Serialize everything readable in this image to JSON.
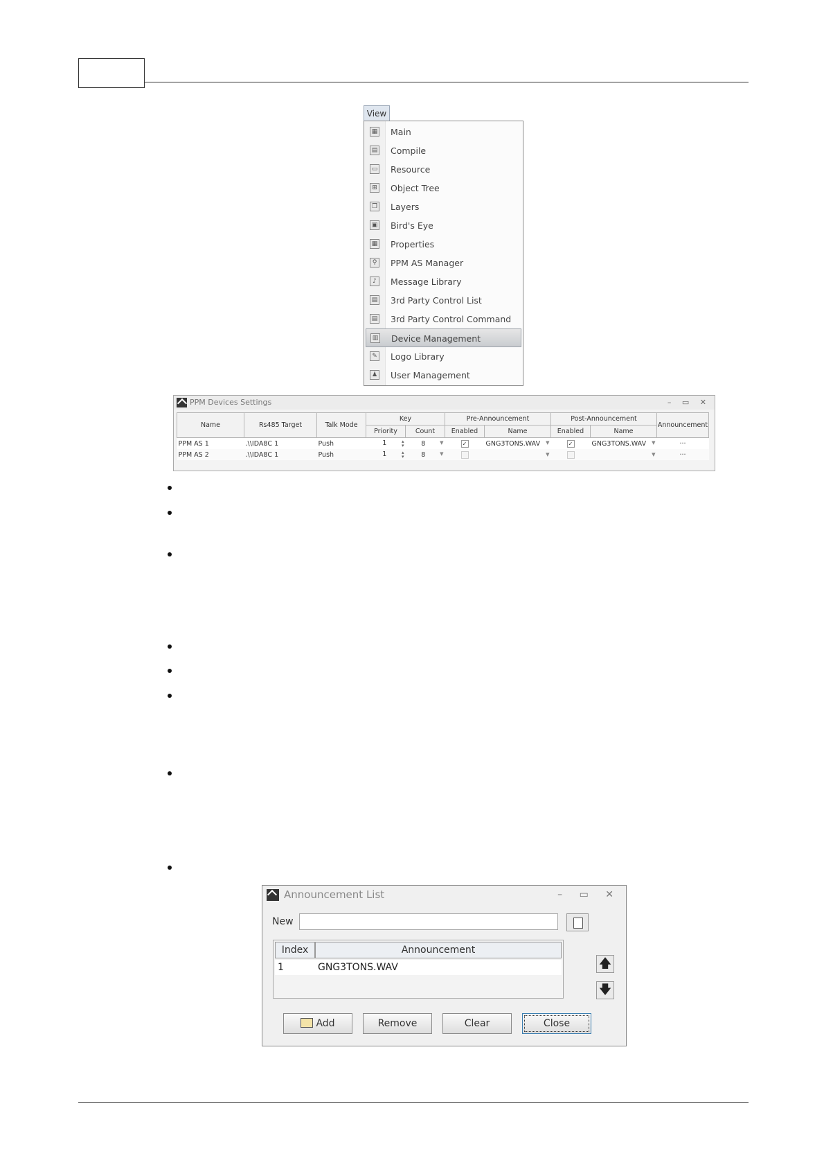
{
  "view_menu": {
    "tab_label": "View",
    "items": [
      {
        "label": "Main",
        "icon": "main-window-icon"
      },
      {
        "label": "Compile",
        "icon": "compile-icon"
      },
      {
        "label": "Resource",
        "icon": "resource-icon"
      },
      {
        "label": "Object Tree",
        "icon": "object-tree-icon"
      },
      {
        "label": "Layers",
        "icon": "layers-icon"
      },
      {
        "label": "Bird's Eye",
        "icon": "birds-eye-icon"
      },
      {
        "label": "Properties",
        "icon": "properties-icon"
      },
      {
        "label": "PPM AS Manager",
        "icon": "ppm-as-manager-icon"
      },
      {
        "label": "Message Library",
        "icon": "message-library-icon"
      },
      {
        "label": "3rd Party Control List",
        "icon": "third-party-list-icon"
      },
      {
        "label": "3rd Party Control Command",
        "icon": "third-party-command-icon"
      },
      {
        "label": "Device Management",
        "icon": "device-management-icon",
        "highlighted": true
      },
      {
        "label": "Logo Library",
        "icon": "logo-library-icon"
      },
      {
        "label": "User Management",
        "icon": "user-management-icon"
      }
    ]
  },
  "ppm_window": {
    "title": "PPM Devices Settings",
    "controls": "– ▭ ✕",
    "headers": {
      "name": "Name",
      "rs485": "Rs485 Target",
      "talk_mode": "Talk Mode",
      "key": "Key",
      "priority": "Priority",
      "count": "Count",
      "pre": "Pre-Announcement",
      "pre_enabled": "Enabled",
      "pre_name": "Name",
      "post": "Post-Announcement",
      "post_enabled": "Enabled",
      "post_name": "Name",
      "announcement": "Announcement"
    },
    "rows": [
      {
        "name": "PPM AS 1",
        "rs485": ".\\\\IDA8C 1",
        "talk_mode": "Push",
        "priority": "1",
        "count": "8",
        "pre_enabled": true,
        "pre_name": "GNG3TONS.WAV",
        "post_enabled": true,
        "post_name": "GNG3TONS.WAV",
        "announcement": "···"
      },
      {
        "name": "PPM AS 2",
        "rs485": ".\\\\IDA8C 1",
        "talk_mode": "Push",
        "priority": "1",
        "count": "8",
        "pre_enabled": false,
        "pre_name": "",
        "post_enabled": false,
        "post_name": "",
        "announcement": "···"
      }
    ]
  },
  "announcement_window": {
    "title": "Announcement List",
    "controls": "– ▭ ✕",
    "new_label": "New",
    "new_value": "",
    "columns": {
      "index": "Index",
      "announcement": "Announcement"
    },
    "rows": [
      {
        "index": "1",
        "announcement": "GNG3TONS.WAV"
      }
    ],
    "buttons": {
      "add": "Add",
      "remove": "Remove",
      "clear": "Clear",
      "close": "Close"
    },
    "up_arrow": "🡅",
    "down_arrow": "🡇"
  }
}
